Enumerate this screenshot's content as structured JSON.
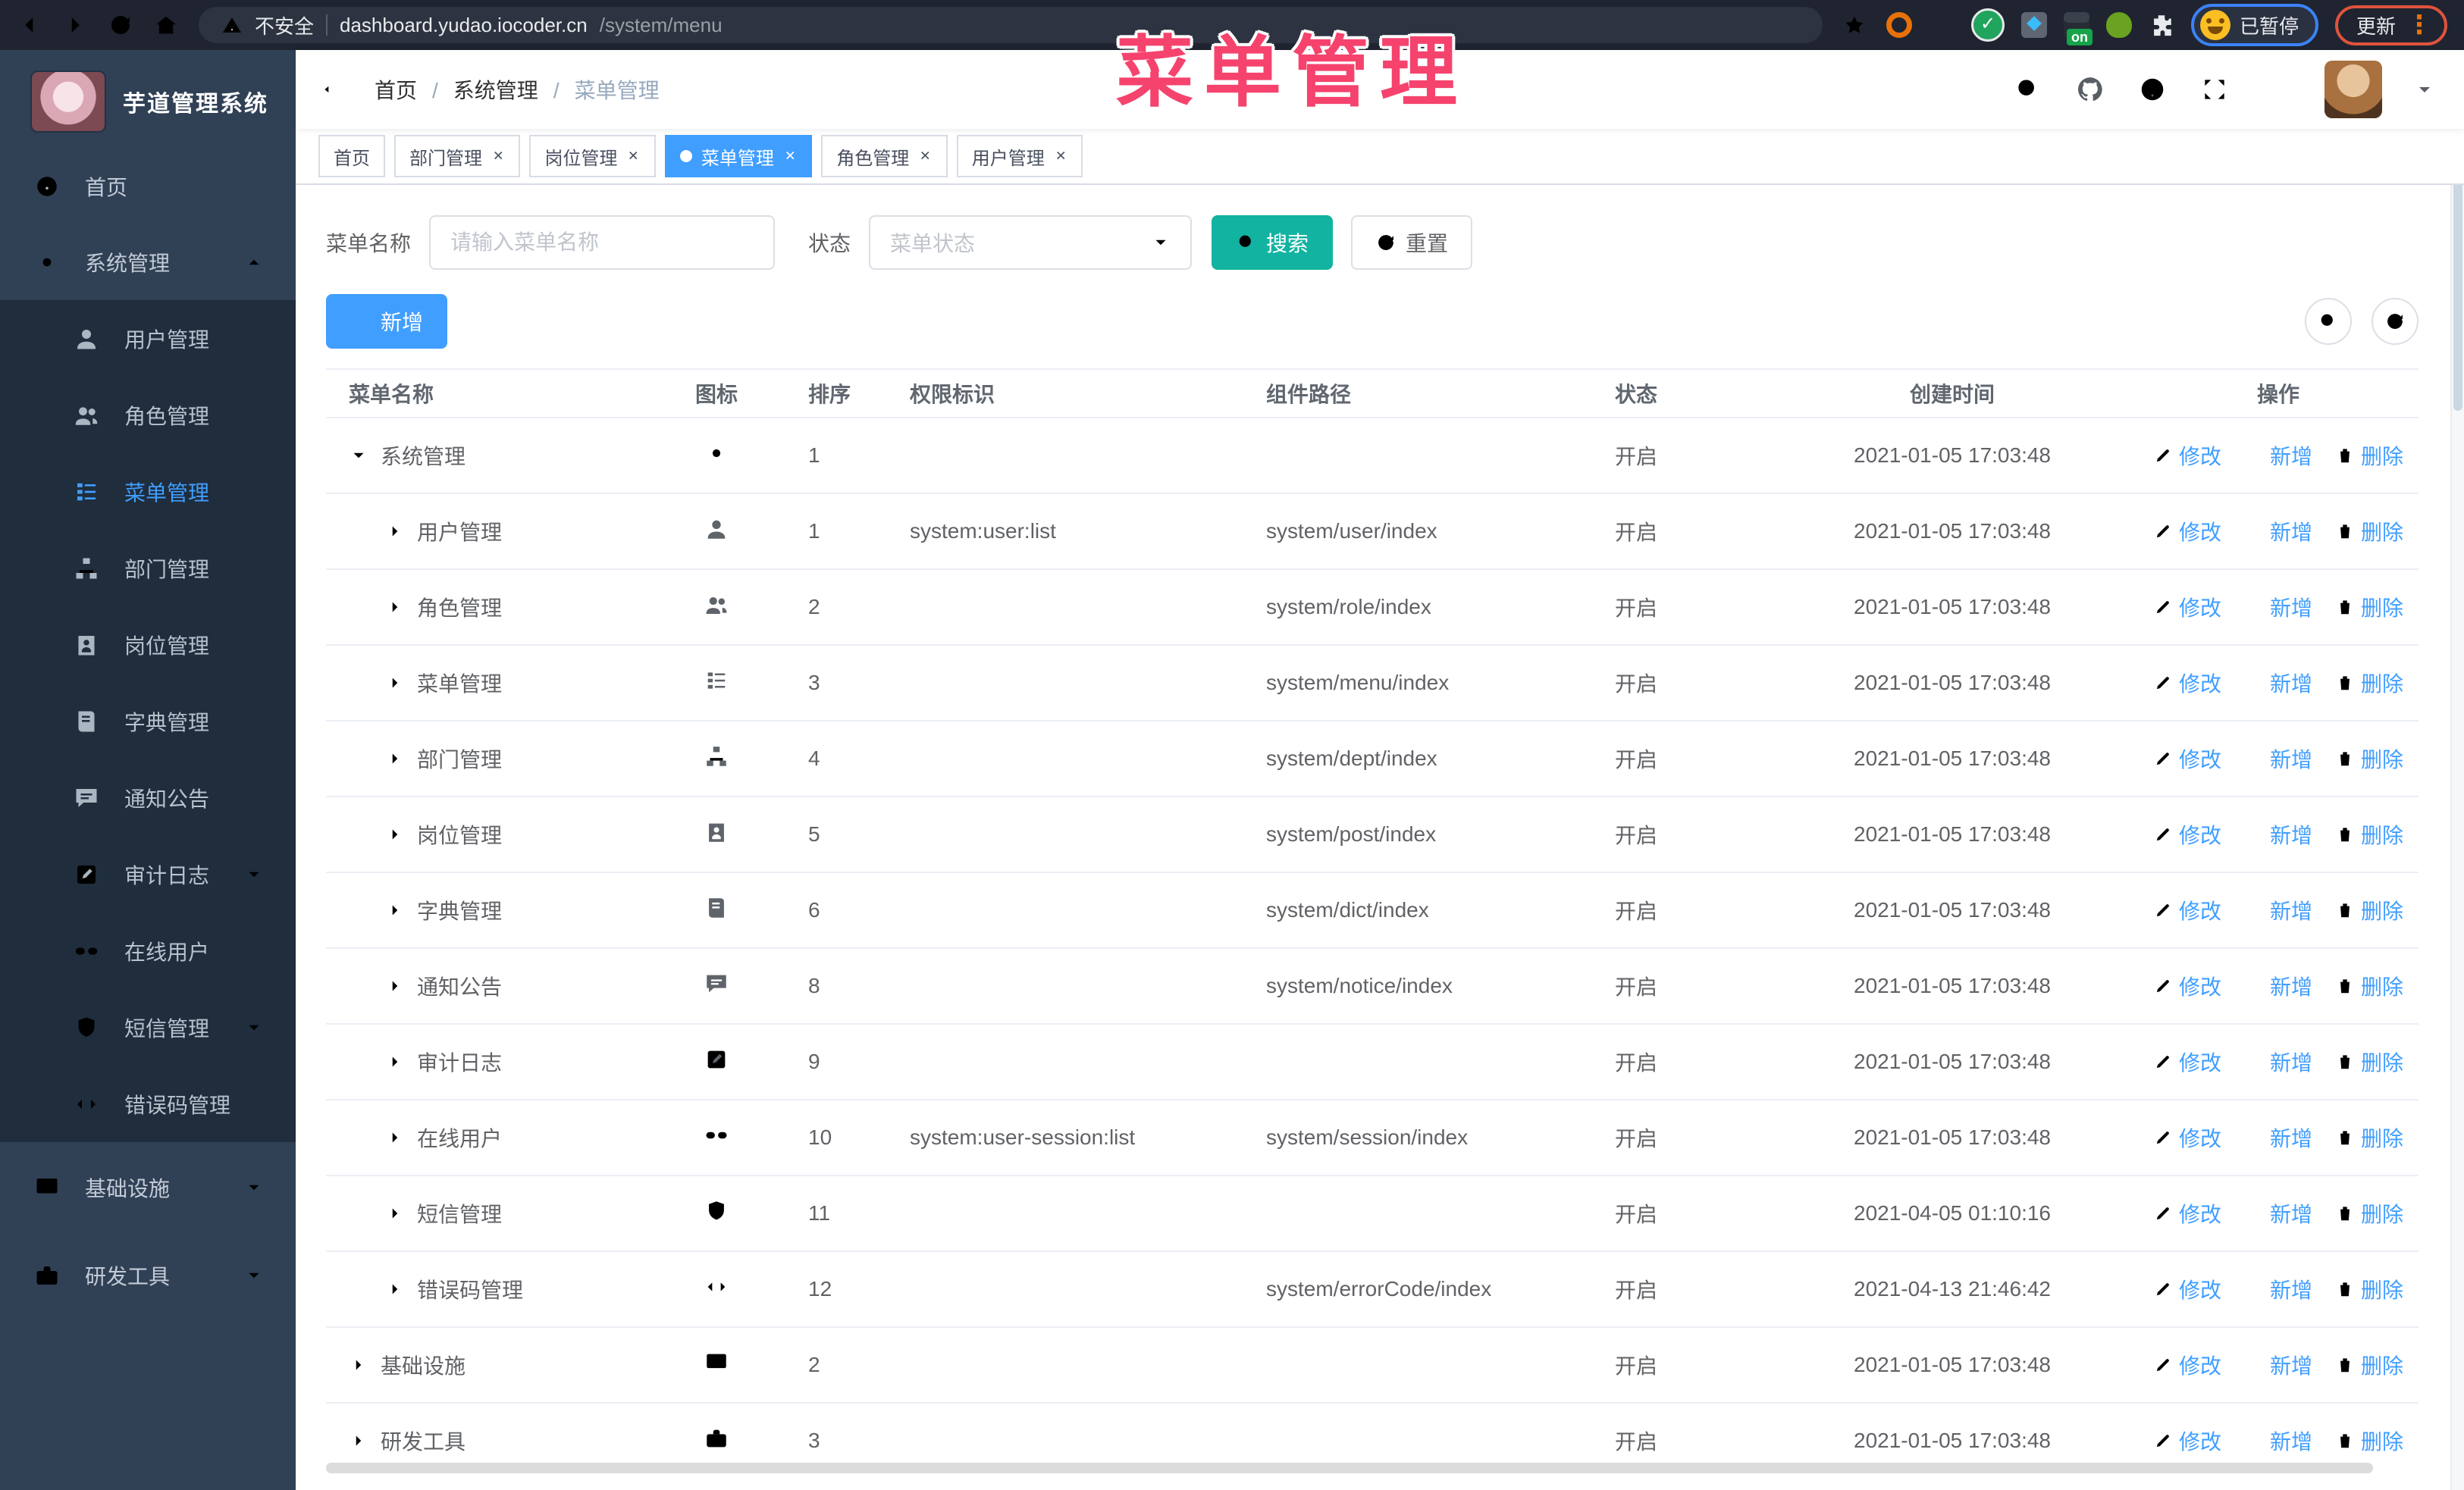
{
  "browser": {
    "security_label": "不安全",
    "url_host": "dashboard.yudao.iocoder.cn",
    "url_path": "/system/menu",
    "ext_on_badge": "on",
    "paused_badge": "已暂停",
    "update_label": "更新"
  },
  "overlay": {
    "title": "菜单管理",
    "color": "#f5436d"
  },
  "sidebar": {
    "app_title": "芋道管理系统",
    "home": "首页",
    "system": "系统管理",
    "system_children": [
      "用户管理",
      "角色管理",
      "菜单管理",
      "部门管理",
      "岗位管理",
      "字典管理",
      "通知公告",
      "审计日志",
      "在线用户",
      "短信管理",
      "错误码管理"
    ],
    "infra": "基础设施",
    "devtools": "研发工具"
  },
  "header": {
    "breadcrumb": [
      "首页",
      "系统管理",
      "菜单管理"
    ]
  },
  "tags": [
    "首页",
    "部门管理",
    "岗位管理",
    "菜单管理",
    "角色管理",
    "用户管理"
  ],
  "filter": {
    "name_label": "菜单名称",
    "name_placeholder": "请输入菜单名称",
    "status_label": "状态",
    "status_placeholder": "菜单状态",
    "search_label": "搜索",
    "reset_label": "重置"
  },
  "toolbar": {
    "add_label": "新增"
  },
  "table": {
    "headers": [
      "菜单名称",
      "图标",
      "排序",
      "权限标识",
      "组件路径",
      "状态",
      "创建时间",
      "操作"
    ],
    "ops": {
      "edit": "修改",
      "add": "新增",
      "del": "删除"
    },
    "rows": [
      {
        "name": "系统管理",
        "sort": "1",
        "permission": "",
        "component": "",
        "status": "开启",
        "created": "2021-01-05 17:03:48"
      },
      {
        "name": "用户管理",
        "sort": "1",
        "permission": "system:user:list",
        "component": "system/user/index",
        "status": "开启",
        "created": "2021-01-05 17:03:48"
      },
      {
        "name": "角色管理",
        "sort": "2",
        "permission": "",
        "component": "system/role/index",
        "status": "开启",
        "created": "2021-01-05 17:03:48"
      },
      {
        "name": "菜单管理",
        "sort": "3",
        "permission": "",
        "component": "system/menu/index",
        "status": "开启",
        "created": "2021-01-05 17:03:48"
      },
      {
        "name": "部门管理",
        "sort": "4",
        "permission": "",
        "component": "system/dept/index",
        "status": "开启",
        "created": "2021-01-05 17:03:48"
      },
      {
        "name": "岗位管理",
        "sort": "5",
        "permission": "",
        "component": "system/post/index",
        "status": "开启",
        "created": "2021-01-05 17:03:48"
      },
      {
        "name": "字典管理",
        "sort": "6",
        "permission": "",
        "component": "system/dict/index",
        "status": "开启",
        "created": "2021-01-05 17:03:48"
      },
      {
        "name": "通知公告",
        "sort": "8",
        "permission": "",
        "component": "system/notice/index",
        "status": "开启",
        "created": "2021-01-05 17:03:48"
      },
      {
        "name": "审计日志",
        "sort": "9",
        "permission": "",
        "component": "",
        "status": "开启",
        "created": "2021-01-05 17:03:48"
      },
      {
        "name": "在线用户",
        "sort": "10",
        "permission": "system:user-session:list",
        "component": "system/session/index",
        "status": "开启",
        "created": "2021-01-05 17:03:48"
      },
      {
        "name": "短信管理",
        "sort": "11",
        "permission": "",
        "component": "",
        "status": "开启",
        "created": "2021-04-05 01:10:16"
      },
      {
        "name": "错误码管理",
        "sort": "12",
        "permission": "",
        "component": "system/errorCode/index",
        "status": "开启",
        "created": "2021-04-13 21:46:42"
      },
      {
        "name": "基础设施",
        "sort": "2",
        "permission": "",
        "component": "",
        "status": "开启",
        "created": "2021-01-05 17:03:48"
      },
      {
        "name": "研发工具",
        "sort": "3",
        "permission": "",
        "component": "",
        "status": "开启",
        "created": "2021-01-05 17:03:48"
      }
    ]
  },
  "colors": {
    "primary": "#409eff",
    "search_button": "#12b3a0",
    "sidebar_bg": "#304156",
    "submenu_bg": "#1f2d3d"
  }
}
